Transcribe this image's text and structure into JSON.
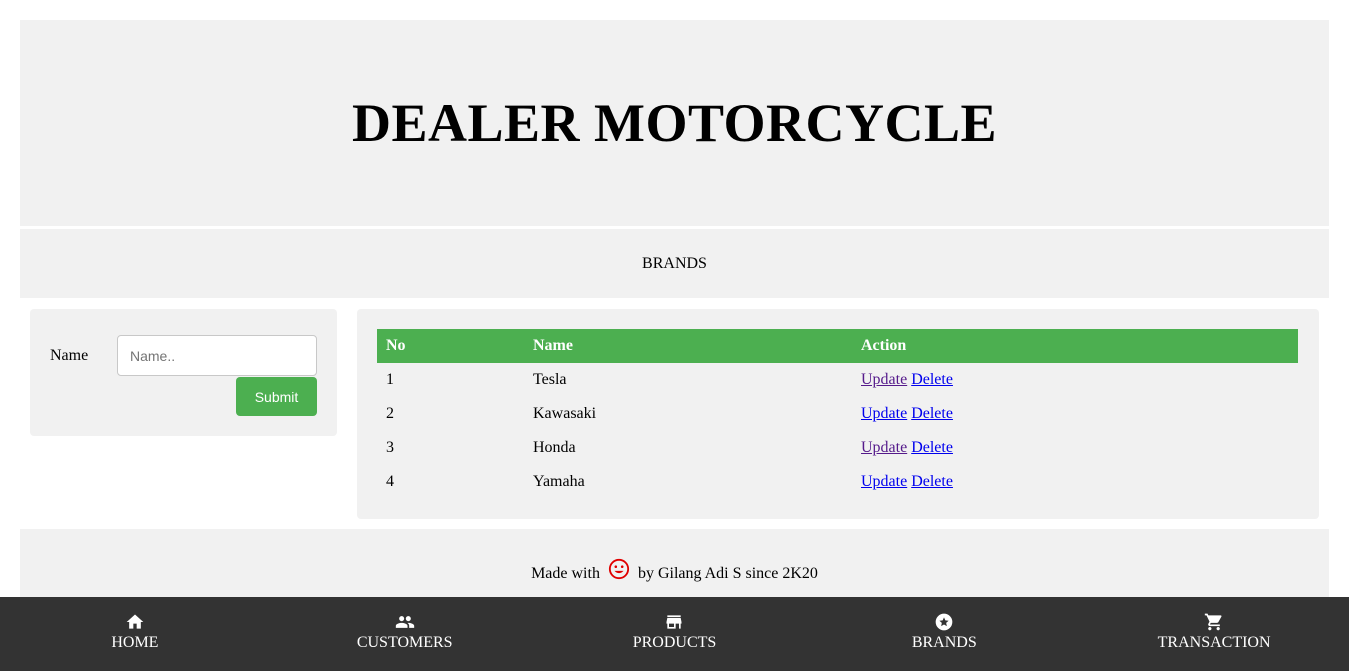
{
  "header": {
    "title": "DEALER MOTORCYCLE"
  },
  "subheader": {
    "title": "BRANDS"
  },
  "form": {
    "name_label": "Name",
    "name_placeholder": "Name..",
    "submit_label": "Submit"
  },
  "table": {
    "headers": {
      "no": "No",
      "name": "Name",
      "action": "Action"
    },
    "rows": [
      {
        "no": "1",
        "name": "Tesla",
        "update": "Update",
        "delete": "Delete"
      },
      {
        "no": "2",
        "name": "Kawasaki",
        "update": "Update",
        "delete": "Delete"
      },
      {
        "no": "3",
        "name": "Honda",
        "update": "Update",
        "delete": "Delete"
      },
      {
        "no": "4",
        "name": "Yamaha",
        "update": "Update",
        "delete": "Delete"
      }
    ]
  },
  "footer": {
    "prefix": "Made with",
    "suffix": "by Gilang Adi S since 2K20",
    "icon": "smiley-icon"
  },
  "nav": {
    "home": "HOME",
    "customers": "CUSTOMERS",
    "products": "PRODUCTS",
    "brands": "BRANDS",
    "transaction": "TRANSACTION"
  },
  "colors": {
    "accent": "#4caf50",
    "nav_bg": "#333333",
    "panel_bg": "#f1f1f1",
    "smiley": "#e00000"
  }
}
